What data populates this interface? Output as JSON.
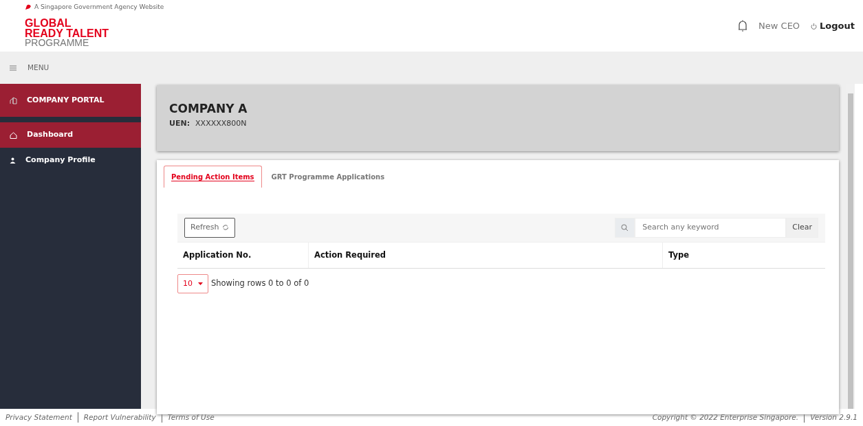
{
  "agency_banner": "A Singapore Government Agency Website",
  "logo": {
    "line_1": "GLOBAL",
    "line_2": "READY TALENT",
    "line_3": "PROGRAMME"
  },
  "user": {
    "name": "New CEO",
    "logout": "Logout"
  },
  "menu_bar": {
    "label": "MENU"
  },
  "sidebar": {
    "items": [
      {
        "label": "COMPANY PORTAL",
        "kind": "header"
      },
      {
        "label": "Dashboard",
        "kind": "link",
        "selected": true
      },
      {
        "label": "Company Profile",
        "kind": "link",
        "selected": false
      }
    ]
  },
  "company": {
    "name": "COMPANY A",
    "uen_label": "UEN:",
    "uen": "XXXXXX800N"
  },
  "tabs": [
    {
      "label": "Pending Action Items",
      "selected": true
    },
    {
      "label": "GRT Programme Applications",
      "selected": false
    }
  ],
  "table": {
    "refresh": "Refresh",
    "search": {
      "placeholder": "Search any keyword"
    },
    "clear": "Clear",
    "columns": [
      "Application No.",
      "Action Required",
      "Type"
    ],
    "page_size": "10",
    "info": "Showing rows 0 to 0 of 0"
  },
  "footer": {
    "links": [
      "Privacy Statement",
      "Report Vulnerability",
      "Terms of Use"
    ],
    "copyright": "Copyright © 2022 Enterprise Singapore.",
    "version": "Version 2.9.1"
  }
}
